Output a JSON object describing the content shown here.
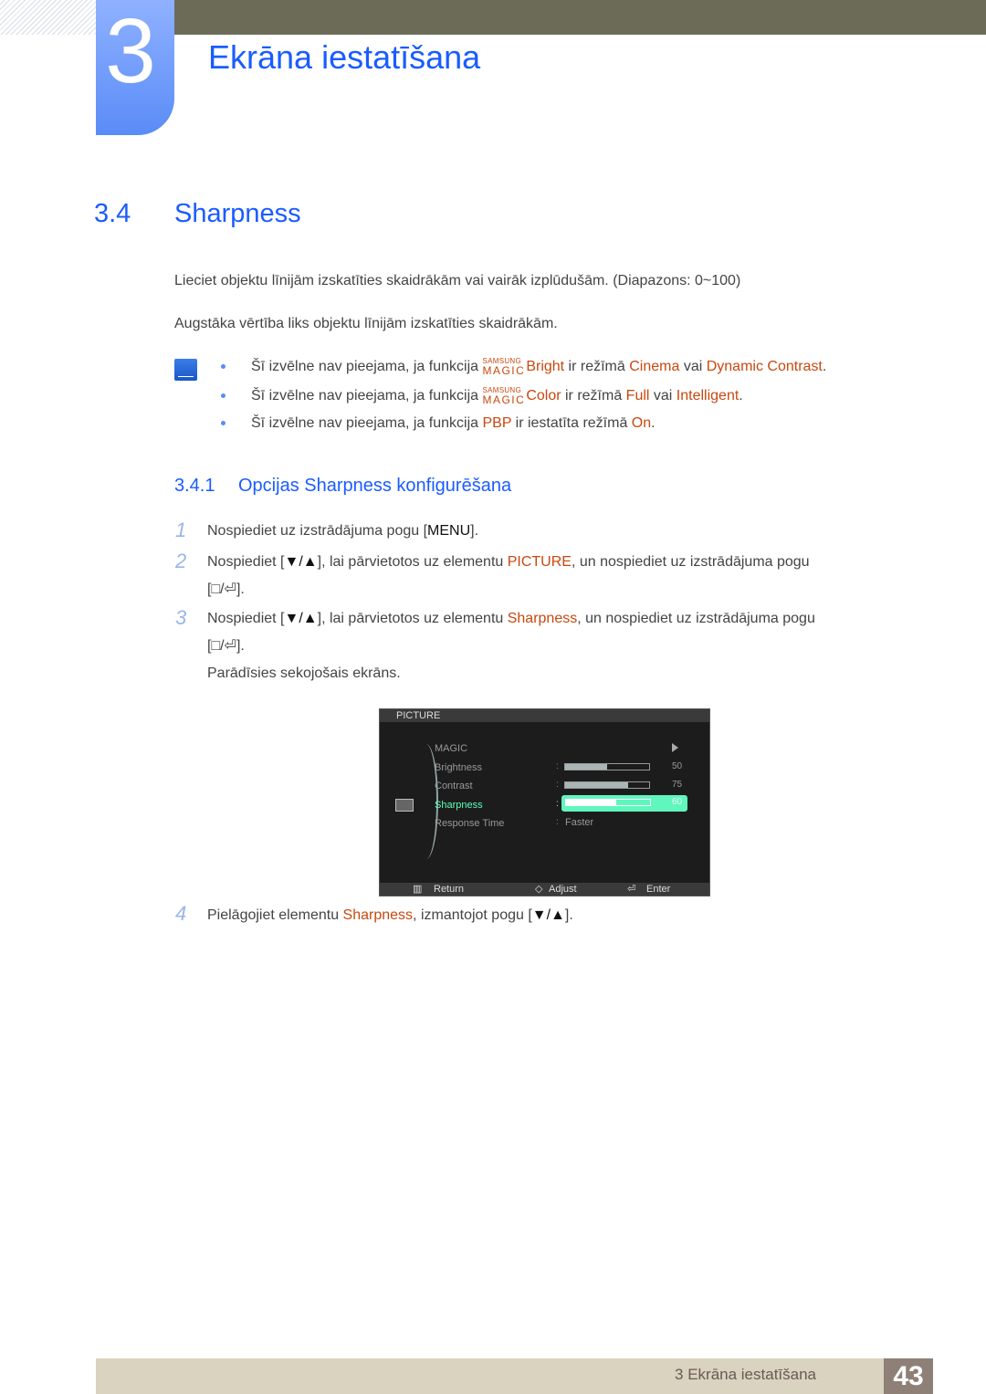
{
  "chapter": {
    "number": "3",
    "title": "Ekrāna iestatīšana"
  },
  "section": {
    "number": "3.4",
    "title": "Sharpness"
  },
  "paragraphs": [
    "Lieciet objektu līnijām izskatīties skaidrākām vai vairāk izplūdušām. (Diapazons: 0~100)",
    "Augstāka vērtība liks objektu līnijām izskatīties skaidrākām."
  ],
  "notes": [
    {
      "pre": "Šī izvēlne nav pieejama, ja funkcija ",
      "magic_top": "SAMSUNG",
      "magic_bottom": "MAGIC",
      "feature": "Bright",
      "mid": " ir režīmā ",
      "opt1": "Cinema",
      "or": " vai ",
      "opt2": "Dynamic Contrast",
      "end": "."
    },
    {
      "pre": "Šī izvēlne nav pieejama, ja funkcija ",
      "magic_top": "SAMSUNG",
      "magic_bottom": "MAGIC",
      "feature": "Color",
      "mid": " ir režīmā ",
      "opt1": "Full",
      "or": " vai ",
      "opt2": "Intelligent",
      "end": "."
    },
    {
      "pre": "Šī izvēlne nav pieejama, ja funkcija ",
      "feature": "PBP",
      "mid": " ir iestatīta režīmā ",
      "opt1": "On",
      "end": "."
    }
  ],
  "subsection": {
    "number": "3.4.1",
    "title": "Opcijas Sharpness konfigurēšana"
  },
  "steps": [
    {
      "num": "1",
      "pre": "Nospiediet uz izstrādājuma pogu [",
      "key": "MENU",
      "post": "]."
    },
    {
      "num": "2",
      "pre": "Nospiediet [",
      "key": "▼/▲",
      "mid": "], lai pārvietotos uz elementu ",
      "hl": "PICTURE",
      "post": ", un nospiediet uz izstrādājuma pogu",
      "line2": "[□/⏎]."
    },
    {
      "num": "3",
      "pre": "Nospiediet [",
      "key": "▼/▲",
      "mid": "], lai pārvietotos uz elementu ",
      "hl": "Sharpness",
      "post": ", un nospiediet uz izstrādājuma pogu",
      "line2": "[□/⏎].",
      "line3": "Parādīsies sekojošais ekrāns."
    },
    {
      "num": "4",
      "pre": "Pielāgojiet elementu ",
      "hl": "Sharpness",
      "mid": ", izmantojot pogu [",
      "key": "▼/▲",
      "post": "]."
    }
  ],
  "osd": {
    "header": "PICTURE",
    "items": [
      {
        "label": "MAGIC"
      },
      {
        "label": "Brightness",
        "value": 50
      },
      {
        "label": "Contrast",
        "value": 75
      },
      {
        "label": "Sharpness",
        "value": 60,
        "selected": true
      },
      {
        "label": "Response Time",
        "text": "Faster"
      }
    ],
    "footer": {
      "return": "Return",
      "adjust": "Adjust",
      "enter": "Enter"
    }
  },
  "footer": {
    "text": "3 Ekrāna iestatīšana",
    "page": "43"
  },
  "colors": {
    "accent_blue": "#1a5cff",
    "highlight": "#c8480e",
    "osd_select": "#5ff7bd"
  }
}
